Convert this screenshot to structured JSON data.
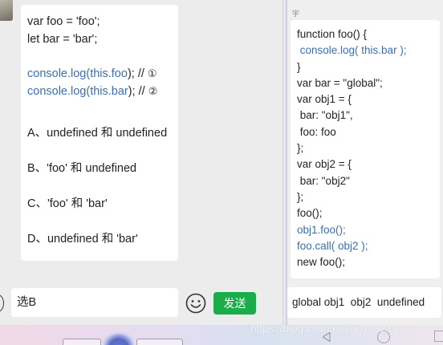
{
  "left_chat": {
    "question_lines": [
      "var foo = 'foo';",
      "let bar = 'bar';"
    ],
    "console_line_1": {
      "fn": "console.log(",
      "kw": "this.foo",
      "rest": "); // ",
      "mark": "①"
    },
    "console_line_2": {
      "fn": "console.log(",
      "kw": "this.bar",
      "rest": "); // ",
      "mark": "②"
    },
    "options": [
      "A、undefined 和 undefined",
      "B、'foo' 和 undefined",
      "C、'foo' 和 'bar'",
      "D、undefined 和 'bar'"
    ]
  },
  "input": {
    "value": "选B"
  },
  "send_label": "发送",
  "right_chat": {
    "sender": "宇",
    "code_lines": [
      "function foo() {",
      " console.log( this.bar );",
      "}",
      "var bar = \"global\";",
      "var obj1 = {",
      " bar: \"obj1\",",
      " foo: foo",
      "};",
      "var obj2 = {",
      " bar: \"obj2\"",
      "};",
      "foo();",
      "obj1.foo();",
      "foo.call( obj2 );",
      "new foo();"
    ],
    "answer": "global obj1  obj2  undefined"
  },
  "watermark": "https://blog.csdn.net/u013321328",
  "colors": {
    "keyword_blue": "#3a6fb4",
    "send_green": "#1aad4a"
  },
  "icons": {
    "voice": "voice-icon",
    "emoji": "emoji-icon",
    "back": "back-triangle-icon",
    "home": "home-circle-icon",
    "recent": "recent-square-icon"
  }
}
